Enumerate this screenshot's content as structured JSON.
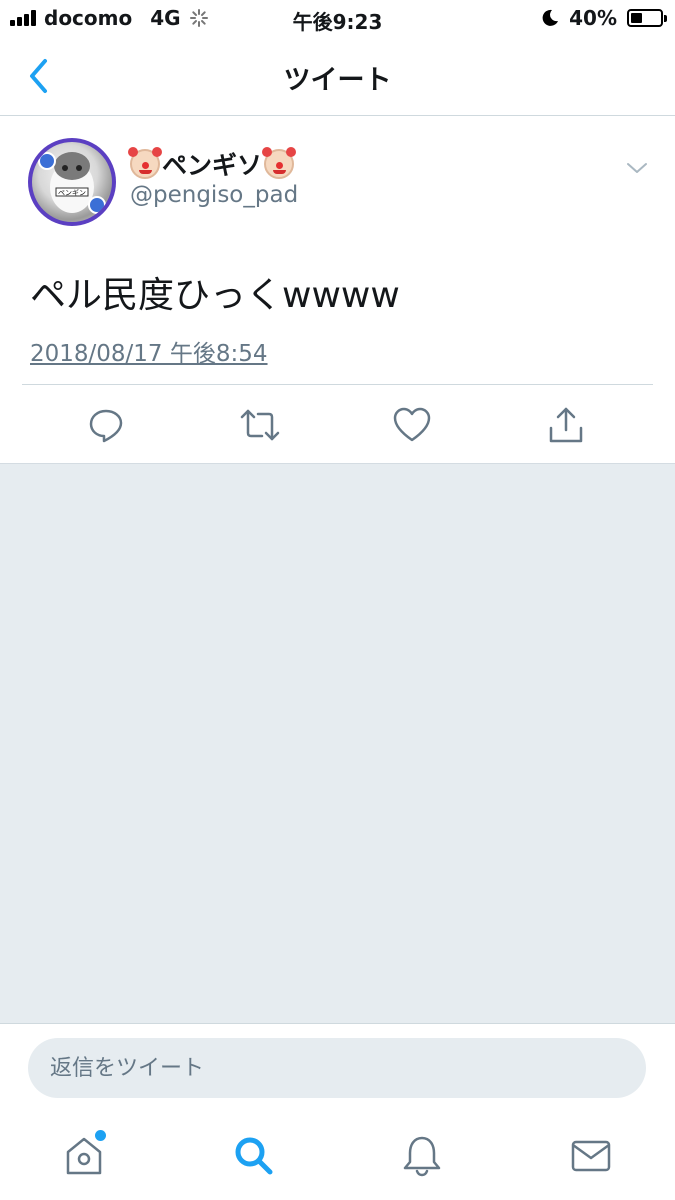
{
  "status_bar": {
    "carrier": "docomo",
    "network": "4G",
    "time": "午後9:23",
    "battery": "40%",
    "battery_level": 0.4
  },
  "nav": {
    "title": "ツイート",
    "back_icon": "chevron-left-icon"
  },
  "tweet": {
    "display_name": "ペンギソ",
    "handle": "@pengiso_pad",
    "text": "ペル民度ひっくwwww",
    "timestamp": "2018/08/17 午後8:54"
  },
  "reply": {
    "placeholder": "返信をツイート"
  },
  "colors": {
    "accent": "#1da1f2",
    "secondary_text": "#657786",
    "background_gray": "#e6ecf0",
    "avatar_ring": "#5b3fc2"
  },
  "tabs": [
    {
      "icon": "home-icon",
      "active": false,
      "has_badge": true
    },
    {
      "icon": "search-icon",
      "active": true,
      "has_badge": false
    },
    {
      "icon": "bell-icon",
      "active": false,
      "has_badge": false
    },
    {
      "icon": "mail-icon",
      "active": false,
      "has_badge": false
    }
  ]
}
